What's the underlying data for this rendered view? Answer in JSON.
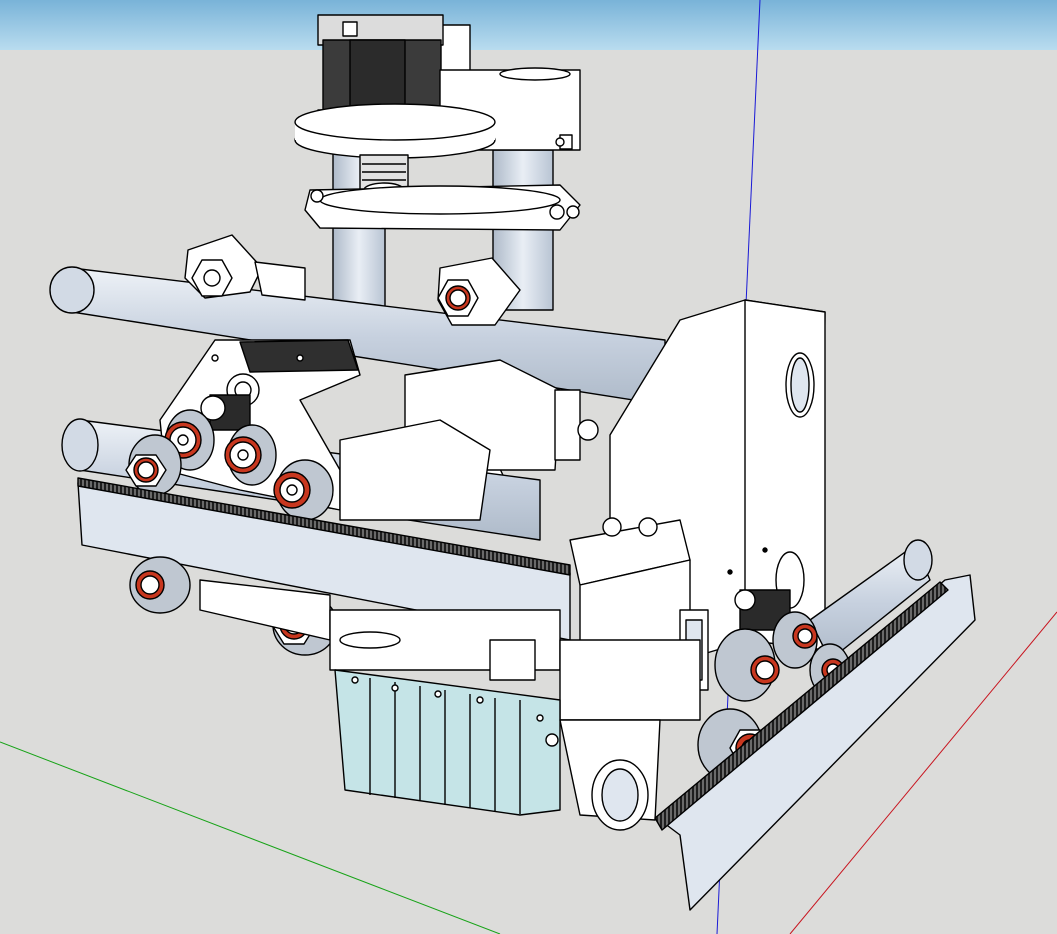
{
  "app": {
    "name": ""
  },
  "viewport": {
    "sky_color": "#79b3d8",
    "sky_color_light": "#b9dcef",
    "ground_color": "#dcdcda",
    "axis_colors": {
      "red": "#c8141e",
      "green": "#17a317",
      "blue": "#1a1ad6"
    }
  },
  "model": {
    "label": "",
    "parts": [
      "stepper-motor",
      "motor-mount-plate",
      "shaft-coupler",
      "lower-mount-plate",
      "vertical-guide-rods",
      "horizontal-rail-upper",
      "horizontal-rail-lower",
      "linear-bearing-blocks",
      "carriage-plate",
      "v-groove-wheels",
      "gear-rack",
      "side-bracket",
      "right-roller-assembly",
      "right-gear-rack",
      "spindle-housing",
      "clear-guard",
      "nozzle"
    ],
    "colors": {
      "metal_light": "#dfe6ef",
      "metal_mid": "#c7d1df",
      "white_part": "#ffffff",
      "motor_body": "#3b3b3b",
      "bearing_red": "#c8371f",
      "guard_tint": "#bfe6ea",
      "rack_teeth": "#2a2a2a",
      "outline": "#000000"
    }
  }
}
